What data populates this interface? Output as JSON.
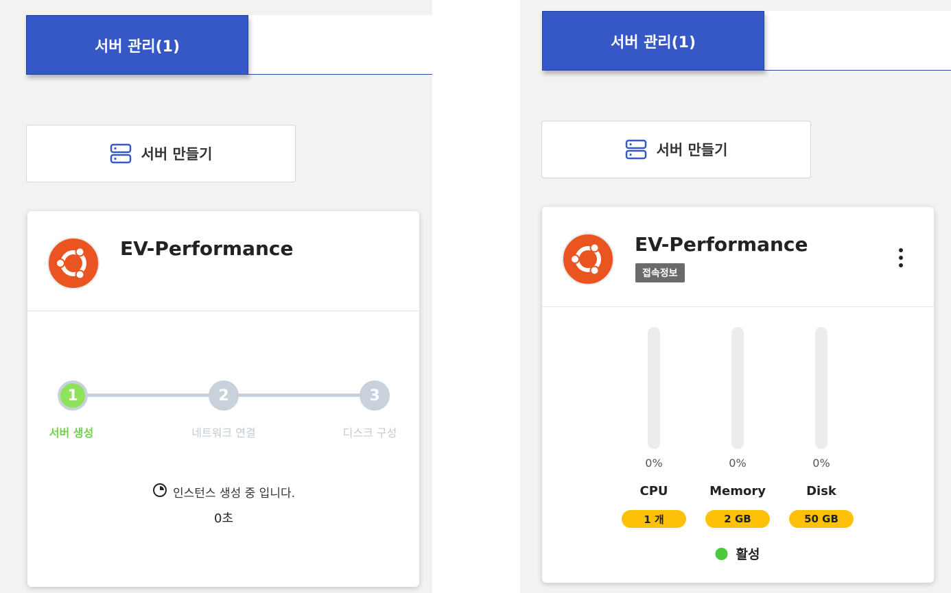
{
  "colors": {
    "tab_active": "#3558c6",
    "ubuntu_orange": "#e95420",
    "step_done": "#8fe25c",
    "step_pending": "#c9d2dc",
    "pill": "#ffc107",
    "active_dot": "#4cc93c"
  },
  "left": {
    "tab_label": "서버 관리(1)",
    "create_button_label": "서버 만들기",
    "create_button_icon": "server-icon",
    "card": {
      "os_icon": "ubuntu-icon",
      "server_name": "EV-Performance",
      "steps": [
        {
          "number": "1",
          "label": "서버 생성",
          "done": true
        },
        {
          "number": "2",
          "label": "네트워크 연결",
          "done": false
        },
        {
          "number": "3",
          "label": "디스크 구성",
          "done": false
        }
      ],
      "status_icon": "clock-icon",
      "status_text": "인스턴스 생성 중 입니다.",
      "elapsed": "0초"
    }
  },
  "right": {
    "tab_label": "서버 관리(1)",
    "create_button_label": "서버 만들기",
    "create_button_icon": "server-icon",
    "card": {
      "os_icon": "ubuntu-icon",
      "server_name": "EV-Performance",
      "connection_badge": "접속정보",
      "menu_icon": "more-vertical-icon",
      "metrics": [
        {
          "name": "CPU",
          "percent": "0%",
          "usage": 0,
          "spec": "1 개"
        },
        {
          "name": "Memory",
          "percent": "0%",
          "usage": 0,
          "spec": "2 GB"
        },
        {
          "name": "Disk",
          "percent": "0%",
          "usage": 0,
          "spec": "50 GB"
        }
      ],
      "state": "활성"
    }
  }
}
